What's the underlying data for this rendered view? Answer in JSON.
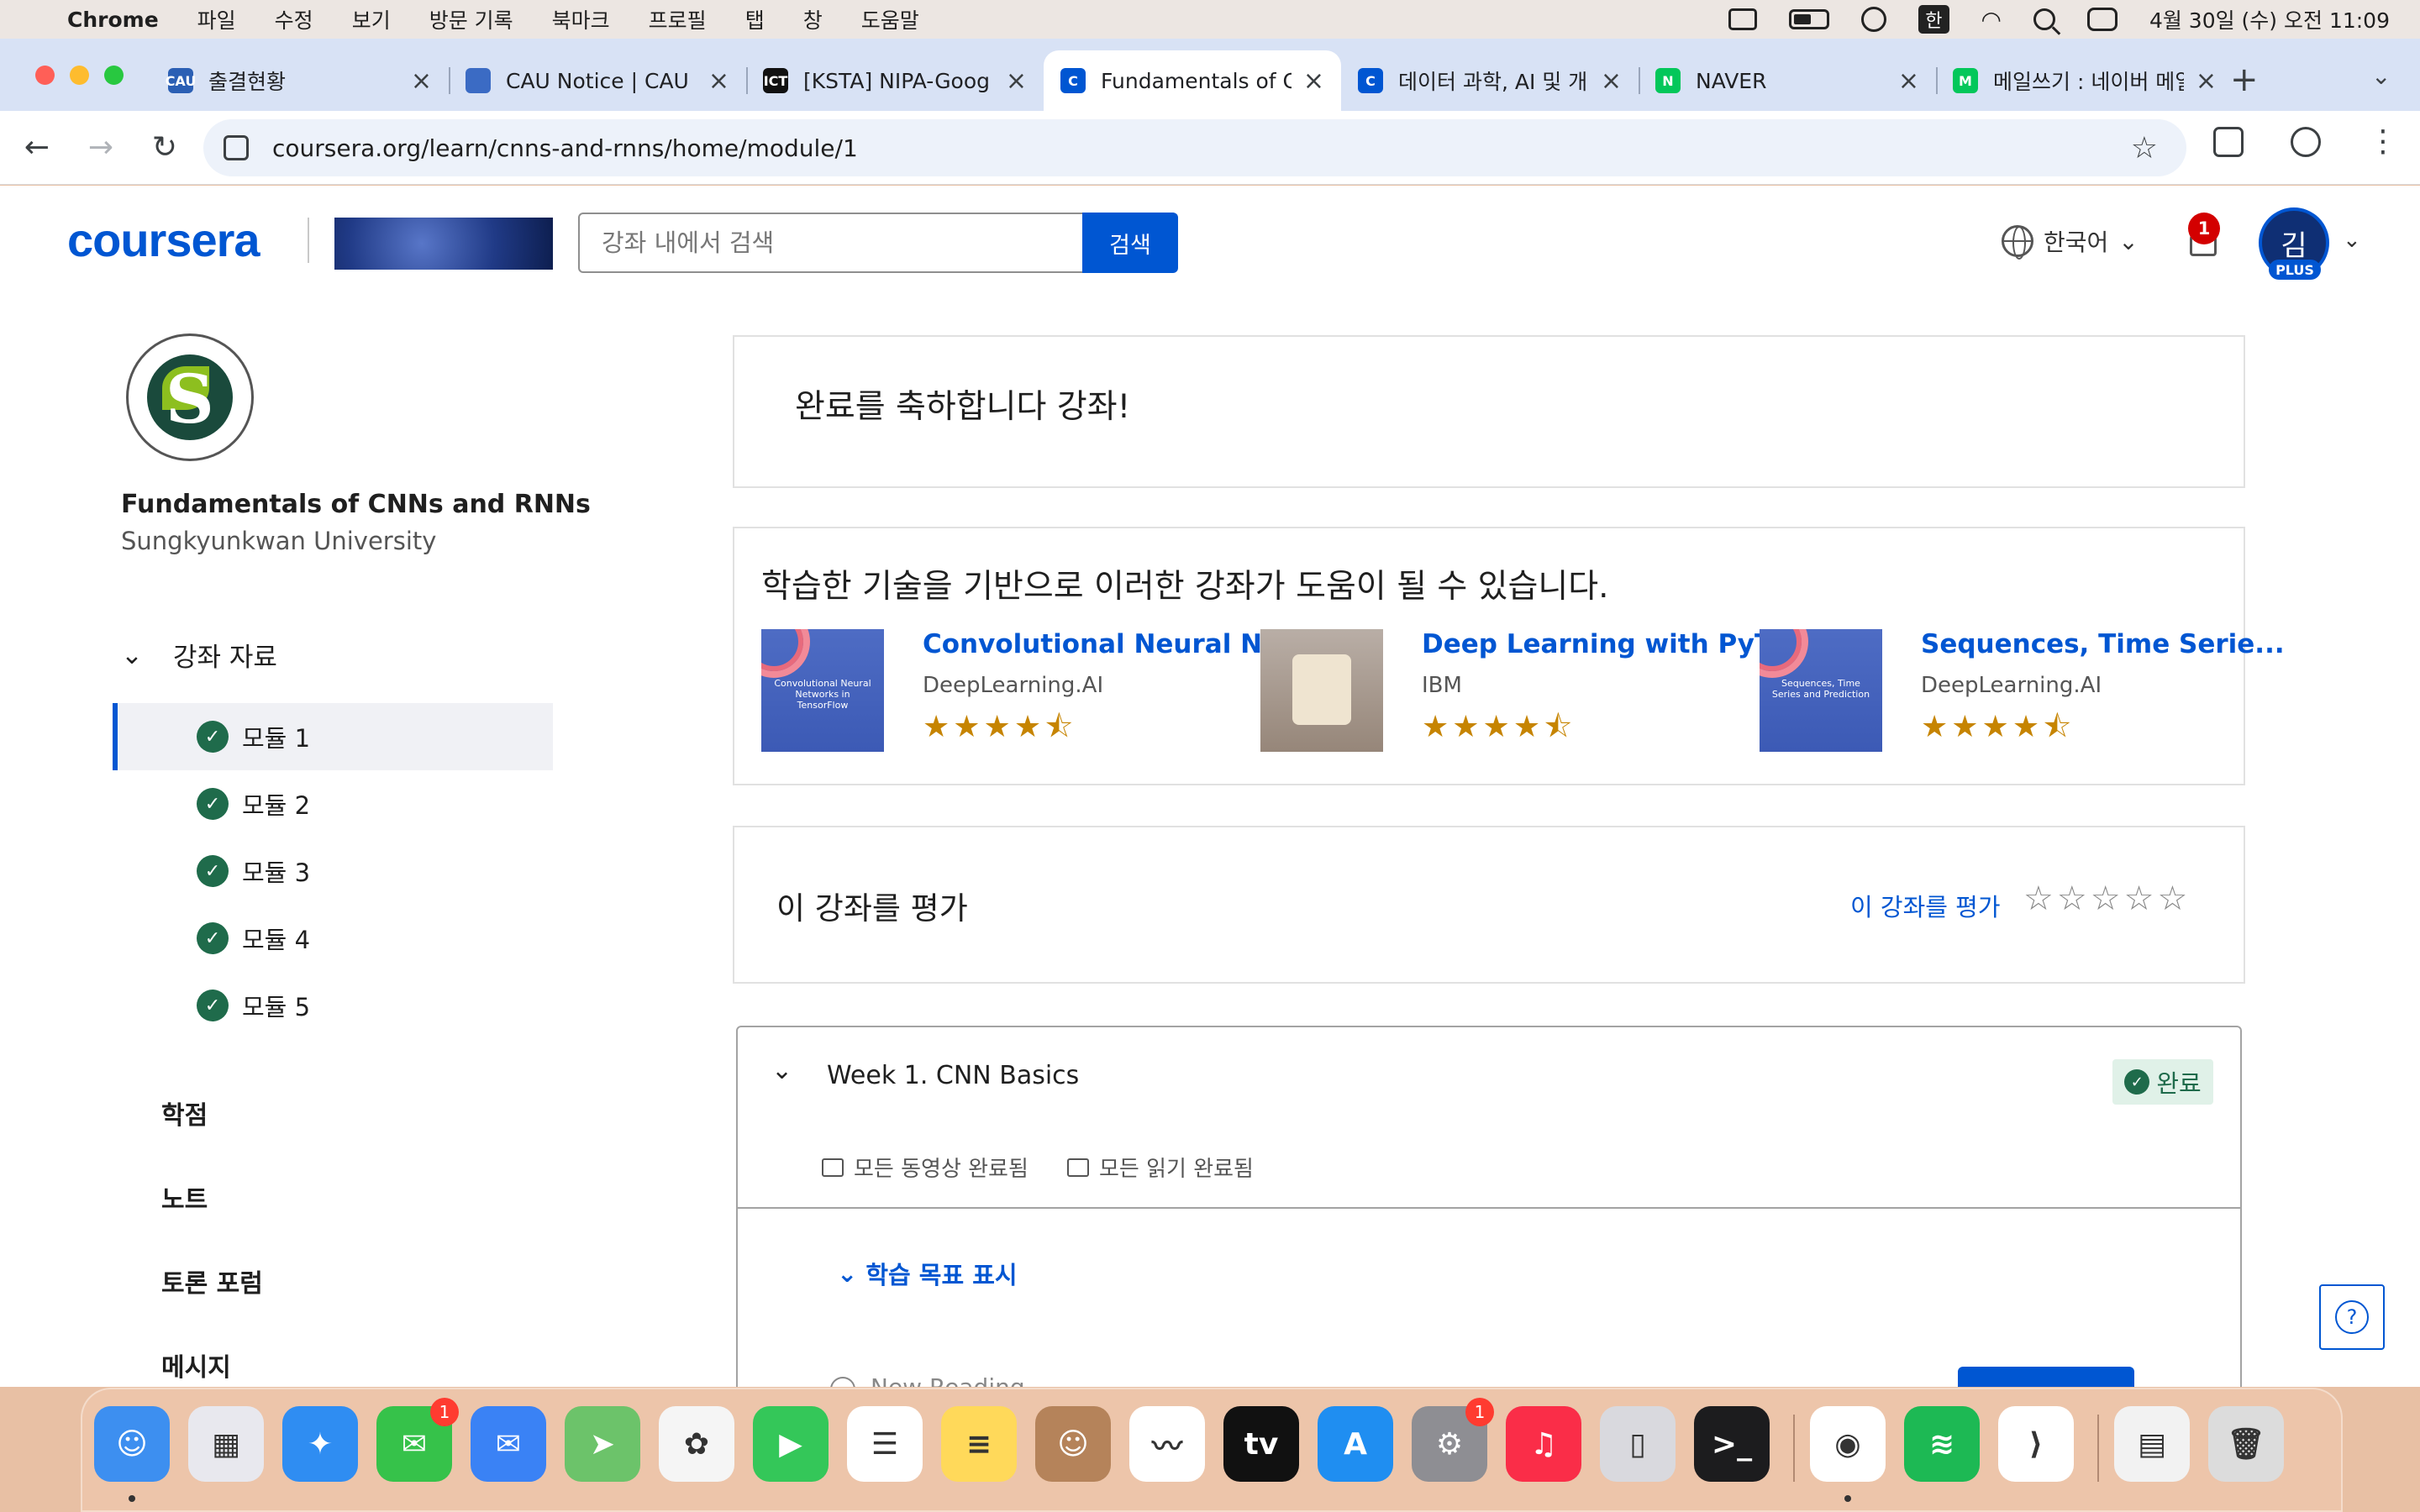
{
  "menubar": {
    "app_name": "Chrome",
    "items": [
      "파일",
      "수정",
      "보기",
      "방문 기록",
      "북마크",
      "프로필",
      "탭",
      "창",
      "도움말"
    ],
    "input_method": "한",
    "datetime": "4월 30일 (수) 오전 11:09"
  },
  "tabs": [
    {
      "label": "출결현황",
      "favicon_color": "#2b5fb4",
      "favicon_text": "CAU"
    },
    {
      "label": "CAU Notice | CAU",
      "favicon_color": "#3b6bc4",
      "favicon_text": ""
    },
    {
      "label": "[KSTA] NIPA-Goog",
      "favicon_color": "#111111",
      "favicon_text": "ICT"
    },
    {
      "label": "Fundamentals of C",
      "favicon_color": "#0056d2",
      "favicon_text": "C"
    },
    {
      "label": "데이터 과학, AI 및 개발",
      "favicon_color": "#0056d2",
      "favicon_text": "C"
    },
    {
      "label": "NAVER",
      "favicon_color": "#03c75a",
      "favicon_text": "N"
    },
    {
      "label": "메일쓰기 : 네이버 메일",
      "favicon_color": "#03c75a",
      "favicon_text": "M"
    }
  ],
  "address_bar": {
    "url": "coursera.org/learn/cnns-and-rnns/home/module/1"
  },
  "header": {
    "logo_text": "coursera",
    "search_placeholder": "강좌 내에서 검색",
    "search_button": "검색",
    "language": "한국어",
    "notification_count": "1",
    "avatar_initial": "김",
    "plan_badge": "PLUS"
  },
  "sidebar": {
    "course_title": "Fundamentals of CNNs and RNNs",
    "course_org": "Sungkyunkwan University",
    "material_header": "강좌 자료",
    "modules": [
      "모듈 1",
      "모듈 2",
      "모듈 3",
      "모듈 4",
      "모듈 5"
    ],
    "links": [
      "학점",
      "노트",
      "토론 포럼",
      "메시지"
    ]
  },
  "main": {
    "congrats_title": "완료를 축하합니다 강좌!",
    "recs_title": "학습한 기술을 기반으로 이러한 강좌가 도움이 될 수 있습니다.",
    "recommendations": [
      {
        "title": "Convolutional Neural N...",
        "org": "DeepLearning.AI",
        "stars": "★★★★⯪",
        "rating": 4.5,
        "thumb_text": "Convolutional Neural Networks in TensorFlow"
      },
      {
        "title": "Deep Learning with PyT...",
        "org": "IBM",
        "stars": "★★★★⯪",
        "rating": 4.5,
        "thumb_text": ""
      },
      {
        "title": "Sequences, Time Serie...",
        "org": "DeepLearning.AI",
        "stars": "★★★★⯪",
        "rating": 4.5,
        "thumb_text": "Sequences, Time Series and Prediction"
      }
    ],
    "rate_title": "이 강좌를 평가",
    "rate_link": "이 강좌를 평가",
    "rate_stars": "☆☆☆☆☆",
    "week": {
      "title": "Week 1. CNN Basics",
      "status": "완료",
      "videos_status": "모든 동영상 완료됨",
      "readings_status": "모든 읽기 완료됨",
      "objectives_link": "학습 목표 표시",
      "next_item": "New Reading"
    }
  },
  "colors": {
    "brand": "#0056d2",
    "success": "#1f6b4b",
    "star": "#c68400"
  },
  "dock": [
    {
      "name": "finder",
      "color": "#3d8ff0",
      "label": "☺"
    },
    {
      "name": "launchpad",
      "color": "#e8e8ee",
      "label": "▦"
    },
    {
      "name": "safari",
      "color": "#2f8df2",
      "label": "✦"
    },
    {
      "name": "messages",
      "color": "#36c24a",
      "label": "✉",
      "badge": "1"
    },
    {
      "name": "mail",
      "color": "#3a82f5",
      "label": "✉"
    },
    {
      "name": "maps",
      "color": "#6cc36a",
      "label": "➤"
    },
    {
      "name": "photos",
      "color": "#f5f5f5",
      "label": "✿"
    },
    {
      "name": "facetime",
      "color": "#34c759",
      "label": "▶"
    },
    {
      "name": "reminders",
      "color": "#ffffff",
      "label": "☰"
    },
    {
      "name": "notes",
      "color": "#ffd95a",
      "label": "≡"
    },
    {
      "name": "contacts",
      "color": "#b5835a",
      "label": "☺"
    },
    {
      "name": "freeform",
      "color": "#ffffff",
      "label": "〰"
    },
    {
      "name": "apple-tv",
      "color": "#111111",
      "label": "tv"
    },
    {
      "name": "app-store",
      "color": "#1f8ef1",
      "label": "A"
    },
    {
      "name": "system-settings",
      "color": "#8e8e93",
      "label": "⚙",
      "badge": "1"
    },
    {
      "name": "music",
      "color": "#fa2d48",
      "label": "♫"
    },
    {
      "name": "iphone-mirroring",
      "color": "#d9d9de",
      "label": "▯"
    },
    {
      "name": "terminal",
      "color": "#1c1c1e",
      "label": ">_"
    },
    {
      "name": "chrome",
      "color": "#ffffff",
      "label": "◉"
    },
    {
      "name": "spotify",
      "color": "#1db954",
      "label": "≋"
    },
    {
      "name": "vscode",
      "color": "#ffffff",
      "label": "⟩"
    },
    {
      "name": "documents",
      "color": "#f2f2f2",
      "label": "▤"
    },
    {
      "name": "trash",
      "color": "#dcdcdc",
      "label": "🗑"
    }
  ]
}
